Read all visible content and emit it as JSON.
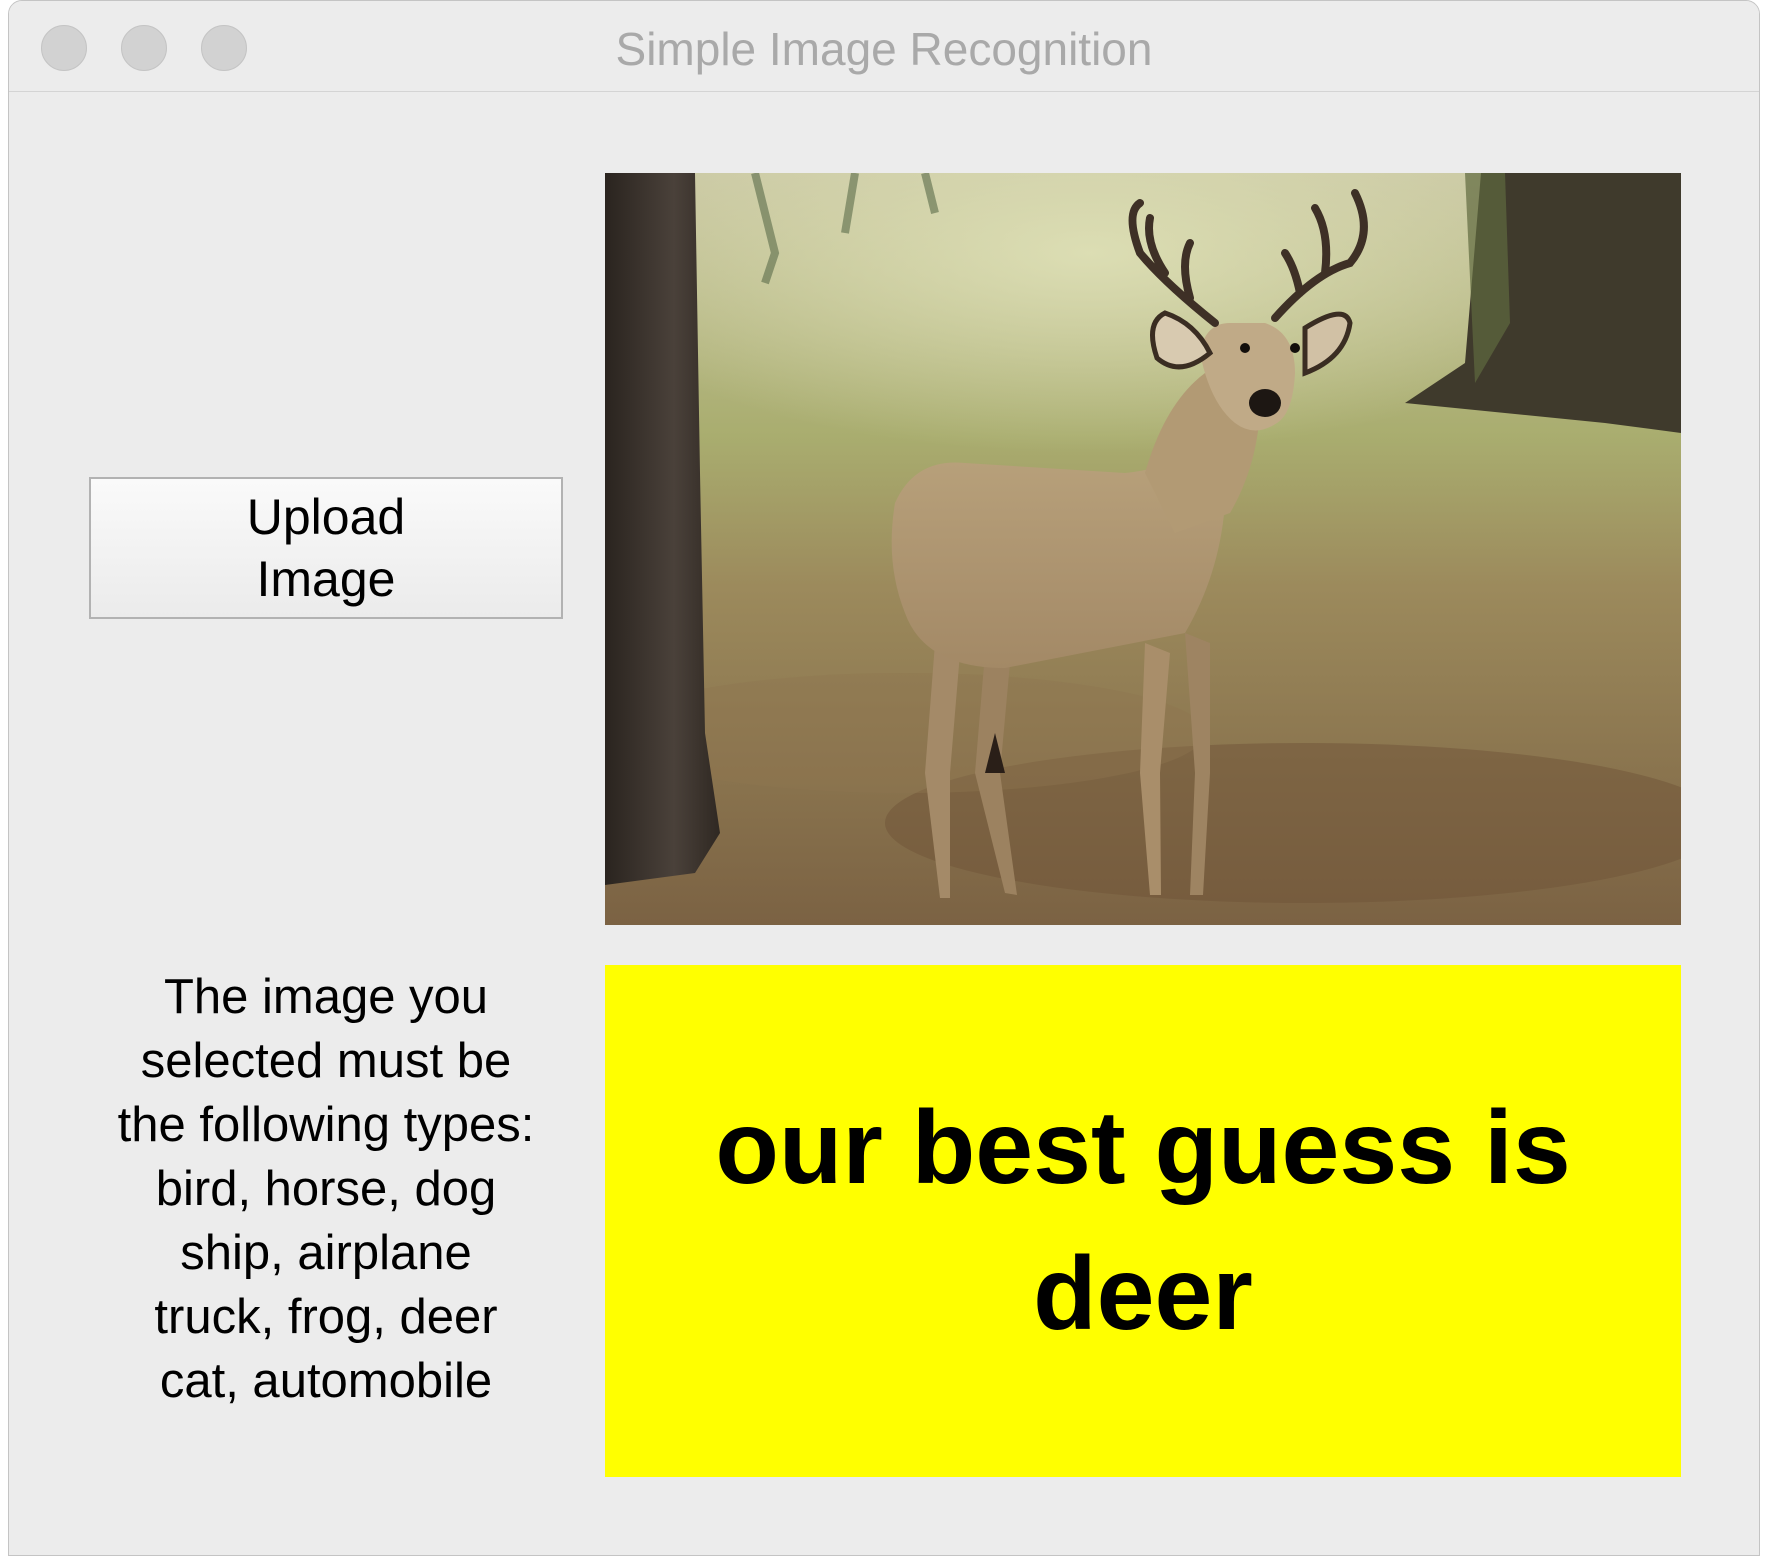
{
  "window": {
    "title": "Simple Image Recognition"
  },
  "upload": {
    "label": "Upload Image"
  },
  "photo": {
    "subject": "deer"
  },
  "info": {
    "text": "The image you\nselected must be\nthe following types:\nbird, horse, dog\nship, airplane\ntruck, frog, deer\ncat, automobile"
  },
  "result": {
    "text": "our best guess is deer",
    "background": "#ffff00"
  },
  "colors": {
    "window_bg": "#ececec",
    "title_text": "#a9a9a9"
  }
}
